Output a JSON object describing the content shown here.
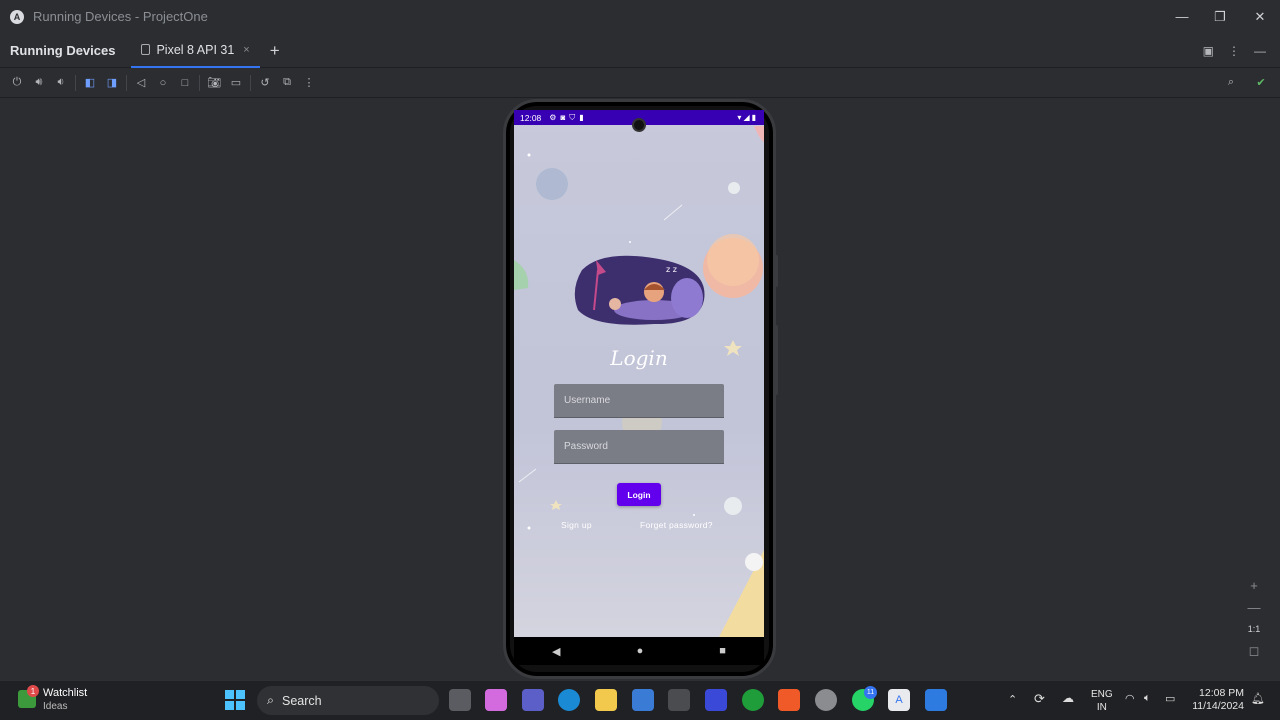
{
  "window": {
    "title": "Running Devices - ProjectOne",
    "minimize": "—",
    "restore": "❐",
    "close": "✕"
  },
  "panel": {
    "title": "Running Devices",
    "tab_label": "Pixel 8 API 31",
    "tab_close": "×",
    "add_tab": "+"
  },
  "toolbar": {
    "buttons": [
      "power-icon",
      "volume-up-icon",
      "volume-down-icon",
      "rotate-left-icon",
      "rotate-right-icon",
      "back-icon",
      "home-icon",
      "overview-icon",
      "screenshot-icon",
      "screen-record-icon",
      "reset-icon",
      "snapshot-icon",
      "more-icon"
    ],
    "zoom_in": "+",
    "zoom_out": "—",
    "zoom_actual": "1:1"
  },
  "device": {
    "status_time": "12:08",
    "status_icons": "⚙◙⛉▮",
    "status_right": "▾◢▮",
    "login_title": "Login",
    "username_placeholder": "Username",
    "password_placeholder": "Password",
    "login_button": "Login",
    "signup_link": "Sign up",
    "forgot_link": "Forget password?",
    "nav_back": "◀",
    "nav_home": "●",
    "nav_recent": "■"
  },
  "taskbar": {
    "widget_title": "Watchlist",
    "widget_subtitle": "Ideas",
    "widget_badge": "1",
    "search_label": "Search",
    "whatsapp_badge": "11",
    "lang_top": "ENG",
    "lang_bottom": "IN",
    "time": "12:08 PM",
    "date": "11/14/2024"
  }
}
